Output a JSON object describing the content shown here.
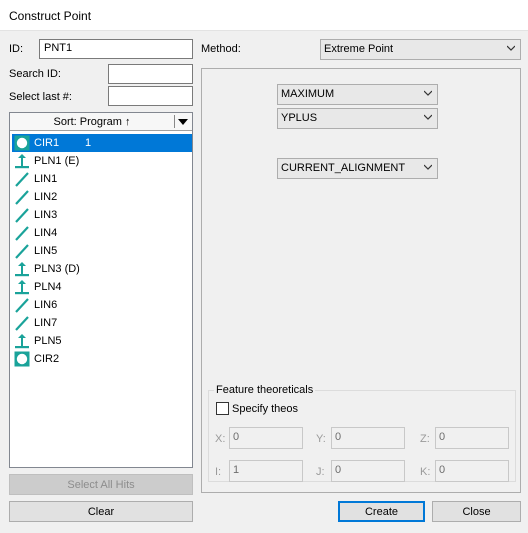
{
  "window": {
    "title": "Construct Point"
  },
  "form": {
    "id_label": "ID:",
    "id_value": "PNT1",
    "search_label": "Search ID:",
    "search_value": "",
    "select_last_label": "Select last #:",
    "select_last_value": "",
    "method_label": "Method:",
    "method_value": "Extreme Point"
  },
  "feature_list": {
    "sort_label": "Sort: Program ↑",
    "items": [
      {
        "name": "CIR1",
        "count": "1",
        "icon": "circle-icon",
        "selected": true
      },
      {
        "name": "PLN1 (E)",
        "count": "",
        "icon": "plane-icon"
      },
      {
        "name": "LIN1",
        "count": "",
        "icon": "line-icon"
      },
      {
        "name": "LIN2",
        "count": "",
        "icon": "line-icon"
      },
      {
        "name": "LIN3",
        "count": "",
        "icon": "line-icon"
      },
      {
        "name": "LIN4",
        "count": "",
        "icon": "line-icon"
      },
      {
        "name": "LIN5",
        "count": "",
        "icon": "line-icon"
      },
      {
        "name": "PLN3 (D)",
        "count": "",
        "icon": "plane-icon"
      },
      {
        "name": "PLN4",
        "count": "",
        "icon": "plane-icon"
      },
      {
        "name": "LIN6",
        "count": "",
        "icon": "line-icon"
      },
      {
        "name": "LIN7",
        "count": "",
        "icon": "line-icon"
      },
      {
        "name": "PLN5",
        "count": "",
        "icon": "plane-icon"
      },
      {
        "name": "CIR2",
        "count": "",
        "icon": "circle-icon"
      }
    ]
  },
  "options": {
    "extreme_type": "MAXIMUM",
    "direction": "YPLUS",
    "alignment": "CURRENT_ALIGNMENT"
  },
  "theoreticals": {
    "group_title": "Feature theoreticals",
    "specify_label": "Specify theos",
    "specify_checked": false,
    "x_label": "X:",
    "x_value": "0",
    "y_label": "Y:",
    "y_value": "0",
    "z_label": "Z:",
    "z_value": "0",
    "i_label": "I:",
    "i_value": "1",
    "j_label": "J:",
    "j_value": "0",
    "k_label": "K:",
    "k_value": "0"
  },
  "buttons": {
    "select_all_hits": "Select All Hits",
    "clear": "Clear",
    "create": "Create",
    "close": "Close"
  },
  "colors": {
    "selection": "#0078d7",
    "icon_teal": "#1aa39a",
    "window_bg": "#f0f0f0"
  }
}
